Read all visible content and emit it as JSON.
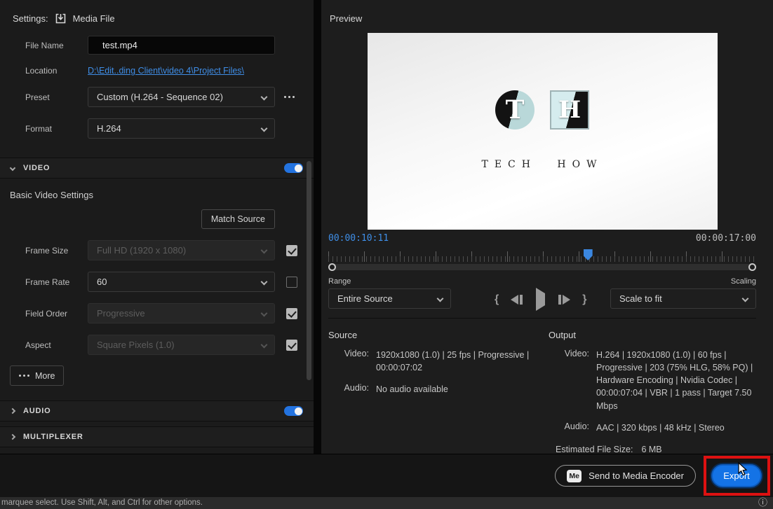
{
  "settings": {
    "title": "Settings:",
    "target": "Media File",
    "fields": {
      "file_name": {
        "label": "File Name",
        "value": "test.mp4"
      },
      "location": {
        "label": "Location",
        "value": "D:\\Edit..ding Client\\video 4\\Project Files\\"
      },
      "preset": {
        "label": "Preset",
        "value": "Custom (H.264 - Sequence 02)"
      },
      "format": {
        "label": "Format",
        "value": "H.264"
      }
    },
    "video_section": {
      "title": "VIDEO",
      "enabled": true,
      "subsection_title": "Basic Video Settings",
      "match_source_label": "Match Source",
      "rows": [
        {
          "label": "Frame Size",
          "value": "Full HD (1920 x 1080)",
          "disabled": true,
          "checked": true
        },
        {
          "label": "Frame Rate",
          "value": "60",
          "disabled": false,
          "checked": false
        },
        {
          "label": "Field Order",
          "value": "Progressive",
          "disabled": true,
          "checked": true
        },
        {
          "label": "Aspect",
          "value": "Square Pixels (1.0)",
          "disabled": true,
          "checked": true
        }
      ],
      "more_label": "More"
    },
    "audio_section": {
      "title": "AUDIO",
      "enabled": true
    },
    "multiplexer_section": {
      "title": "MULTIPLEXER"
    }
  },
  "preview": {
    "title": "Preview",
    "logo": {
      "t": "T",
      "h": "H",
      "caption": "TECH HOW"
    },
    "current_time": "00:00:10:11",
    "duration": "00:00:17:00",
    "playhead_percent": 60.6,
    "range_label": "Range",
    "range_value": "Entire Source",
    "scaling_label": "Scaling",
    "scaling_value": "Scale to fit"
  },
  "source": {
    "title": "Source",
    "video_label": "Video:",
    "video_value": "1920x1080 (1.0) | 25 fps | Progressive | 00:00:07:02",
    "audio_label": "Audio:",
    "audio_value": "No audio available"
  },
  "output": {
    "title": "Output",
    "video_label": "Video:",
    "video_value": "H.264 | 1920x1080 (1.0) | 60 fps | Progressive | 203 (75% HLG, 58% PQ) | Hardware Encoding | Nvidia Codec | 00:00:07:04 | VBR | 1 pass | Target 7.50 Mbps",
    "audio_label": "Audio:",
    "audio_value": "AAC | 320 kbps | 48 kHz | Stereo",
    "file_size_label": "Estimated File Size:",
    "file_size_value": "6 MB"
  },
  "footer": {
    "me_badge": "Me",
    "send_button_label": "Send to Media Encoder",
    "export_button_label": "Export"
  },
  "status_bar": {
    "message": "marquee select. Use Shift, Alt, and Ctrl for other options."
  },
  "icons": {
    "in_brace": "{",
    "out_brace": "}",
    "info": "ⓘ"
  },
  "colors": {
    "accent_blue": "#1473e6",
    "link_blue": "#3f8de6",
    "timecode_blue": "#3f8fe8",
    "toggle_blue": "#2373e0",
    "annotation_red": "#dd1111"
  }
}
